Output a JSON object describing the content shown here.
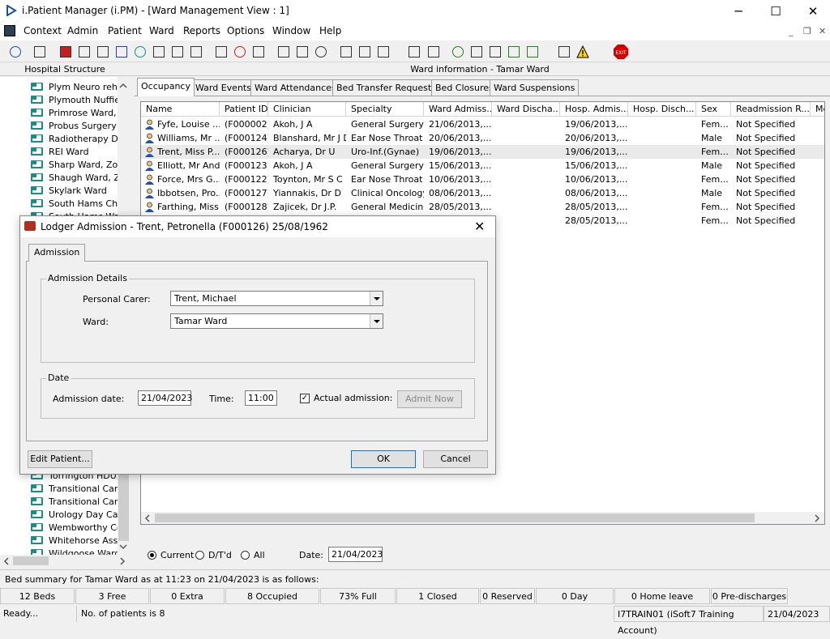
{
  "window": {
    "title": "i.Patient Manager (i.PM) - [Ward Management View : 1]",
    "min": "─",
    "max": "☐",
    "close": "✕"
  },
  "menu": [
    "Context",
    "Admin",
    "Patient",
    "Ward",
    "Reports",
    "Options",
    "Window",
    "Help"
  ],
  "mdi_controls": {
    "min": "_",
    "restore": "❐",
    "close": "✕"
  },
  "left_pane": {
    "header": "Hospital Structure",
    "items": [
      "Plym Neuro rehab",
      "Plymouth Nuffield",
      "Primrose Ward, Z",
      "Probus Surgery W",
      "Radiotherapy Day",
      "REI Ward",
      "Sharp Ward, Zon",
      "Shaugh Ward, Zo",
      "Skylark Ward",
      "South Hams Cher",
      "South Hams Ward",
      "Torrington HDU,",
      "Transitional Care",
      "Transitional Care",
      "Urology Day Case",
      "Wembworthy Cer",
      "Whitehorse Asse",
      "Wildgoose Ward"
    ]
  },
  "right_pane": {
    "header": "Ward information - Tamar Ward",
    "tabs": [
      "Occupancy",
      "Ward Events",
      "Ward Attendances",
      "Bed Transfer Requests",
      "Bed Closures",
      "Ward Suspensions"
    ],
    "columns": [
      "Name",
      "Patient ID",
      "Clinician",
      "Specialty",
      "Ward Admiss...",
      "Ward Discha...",
      "Hosp. Admis...",
      "Hosp. Disch...",
      "Sex",
      "Readmission R...",
      "Me"
    ],
    "rows": [
      {
        "name": "Fyfe, Louise ...",
        "id": "(F000002)",
        "clinician": "Akoh, J A",
        "specialty": "General Surgery",
        "ward_adm": "21/06/2013,...",
        "ward_dis": "",
        "hosp_adm": "19/06/2013,...",
        "hosp_dis": "",
        "sex": "Fem...",
        "readm": "Not Specified"
      },
      {
        "name": "Williams, Mr ...",
        "id": "(F000124)",
        "clinician": "Blanshard, Mr J D",
        "specialty": "Ear Nose Throat",
        "ward_adm": "20/06/2013,...",
        "ward_dis": "",
        "hosp_adm": "20/06/2013,...",
        "hosp_dis": "",
        "sex": "Male",
        "readm": "Not Specified"
      },
      {
        "name": "Trent, Miss P...",
        "id": "(F000126)",
        "clinician": "Acharya, Dr U",
        "specialty": "Uro-Inf.(Gynae)",
        "ward_adm": "19/06/2013,...",
        "ward_dis": "",
        "hosp_adm": "19/06/2013,...",
        "hosp_dis": "",
        "sex": "Fem...",
        "readm": "Not Specified"
      },
      {
        "name": "Elliott, Mr And...",
        "id": "(F000123)",
        "clinician": "Akoh, J A",
        "specialty": "General Surgery",
        "ward_adm": "15/06/2013,...",
        "ward_dis": "",
        "hosp_adm": "15/06/2013,...",
        "hosp_dis": "",
        "sex": "Male",
        "readm": "Not Specified"
      },
      {
        "name": "Force, Mrs G...",
        "id": "(F000122)",
        "clinician": "Toynton, Mr S C",
        "specialty": "Ear Nose Throat",
        "ward_adm": "10/06/2013,...",
        "ward_dis": "",
        "hosp_adm": "10/06/2013,...",
        "hosp_dis": "",
        "sex": "Fem...",
        "readm": "Not Specified"
      },
      {
        "name": "Ibbotsen, Pro...",
        "id": "(F000127)",
        "clinician": "Yiannakis, Dr D",
        "specialty": "Clinical Oncology",
        "ward_adm": "08/06/2013,...",
        "ward_dis": "",
        "hosp_adm": "08/06/2013,...",
        "hosp_dis": "",
        "sex": "Male",
        "readm": "Not Specified"
      },
      {
        "name": "Farthing, Miss...",
        "id": "(F000128)",
        "clinician": "Zajicek, Dr J.P.",
        "specialty": "General Medicine",
        "ward_adm": "28/05/2013,...",
        "ward_dis": "",
        "hosp_adm": "28/05/2013,...",
        "hosp_dis": "",
        "sex": "Fem...",
        "readm": "Not Specified"
      },
      {
        "name": "",
        "id": "",
        "clinician": "",
        "specialty": "",
        "ward_adm": "",
        "ward_dis": "",
        "hosp_adm": "28/05/2013,...",
        "hosp_dis": "",
        "sex": "Fem...",
        "readm": "Not Specified"
      }
    ],
    "filter": {
      "current": "Current",
      "dtd": "D/T'd",
      "all": "All",
      "date_label": "Date:",
      "date_value": "21/04/2023"
    }
  },
  "summary": {
    "text": "Bed summary for Tamar Ward as at 11:23 on 21/04/2023 is as follows:",
    "cells": [
      "12 Beds",
      "3 Free",
      "0 Extra",
      "8 Occupied",
      "73% Full",
      "1 Closed",
      "0 Reserved",
      "0 Day",
      "0 Home leave",
      "0 Pre-discharges"
    ]
  },
  "status": {
    "ready": "Ready...",
    "patients": "No. of patients is 8",
    "account": "I7TRAIN01 (iSoft7 Training Account)",
    "date": "21/04/2023"
  },
  "dialog": {
    "title": "Lodger Admission - Trent, Petronella (F000126) 25/08/1962",
    "close": "✕",
    "tab": "Admission",
    "details_group": "Admission Details",
    "carer_label": "Personal Carer:",
    "carer_value": "Trent, Michael",
    "ward_label": "Ward:",
    "ward_value": "Tamar Ward",
    "date_group": "Date",
    "adm_date_label": "Admission date:",
    "adm_date_value": "21/04/2023",
    "time_label": "Time:",
    "time_value": "11:00",
    "actual_label": "Actual admission:",
    "admit_now": "Admit Now",
    "edit_patient": "Edit Patient...",
    "ok": "OK",
    "cancel": "Cancel"
  },
  "colors": {
    "accent": "#0078d7",
    "selected_row": "#eaeaea",
    "exit_icon": "#d40000"
  }
}
